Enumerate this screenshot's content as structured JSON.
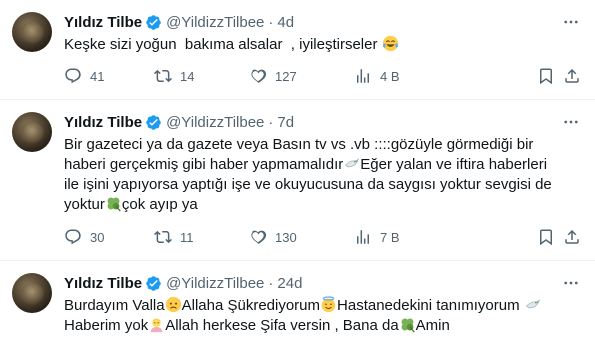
{
  "tweets": [
    {
      "name": "Yıldız Tilbe",
      "handle": "@YildizzTilbee",
      "dot": "·",
      "time": "4d",
      "text_parts": [
        "Keşke sizi yoğun  bakıma alsalar  , iyileştirseler "
      ],
      "reply_count": "41",
      "retweet_count": "14",
      "like_count": "127",
      "view_count": "4 B"
    },
    {
      "name": "Yıldız Tilbe",
      "handle": "@YildizzTilbee",
      "dot": "·",
      "time": "7d",
      "text_parts": [
        "Bir gazeteci ya da gazete veya Basın tv vs .vb ::::gözüyle görmediği bir\nhaberi gerçekmiş gibi haber yapmamalıdır",
        "Eğer yalan ve iftira haberleri\nile işini yapıyorsa yaptığı işe ve okuyucusuna da saygısı yoktur sevgisi de\nyoktur",
        "çok ayıp ya"
      ],
      "reply_count": "30",
      "retweet_count": "11",
      "like_count": "130",
      "view_count": "7 B"
    },
    {
      "name": "Yıldız Tilbe",
      "handle": "@YildizzTilbee",
      "dot": "·",
      "time": "24d",
      "text_parts": [
        "Burdayım Valla",
        "Allaha Şükrediyorum",
        "Hastanedekini tanımıyorum ",
        "\nHaberim yok",
        "Allah herkese Şifa versin , Bana da",
        "Amin"
      ]
    }
  ],
  "icons": {
    "verified": "verified-badge-icon",
    "more": "more-icon",
    "reply": "reply-icon",
    "retweet": "retweet-icon",
    "like": "heart-icon",
    "views": "views-icon",
    "bookmark": "bookmark-icon",
    "share": "share-icon"
  },
  "colors": {
    "accent": "#1d9bf0",
    "secondary_text": "#536471",
    "divider": "#eff3f4"
  }
}
